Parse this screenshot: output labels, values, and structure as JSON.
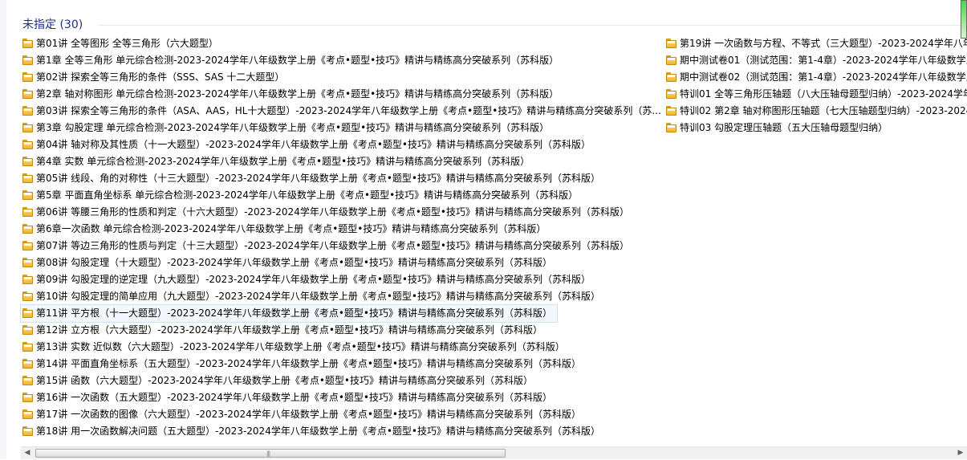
{
  "group": {
    "title": "未指定 (30)"
  },
  "left_items": [
    "第01讲 全等图形 全等三角形（六大题型）",
    "第1章 全等三角形 单元综合检测-2023-2024学年八年级数学上册《考点•题型•技巧》精讲与精练高分突破系列（苏科版）",
    "第02讲 探索全等三角形的条件（SSS、SAS 十二大题型）",
    "第2章 轴对称图形 单元综合检测-2023-2024学年八年级数学上册《考点•题型•技巧》精讲与精练高分突破系列（苏科版）",
    "第03讲 探索全等三角形的条件（ASA、AAS，HL十大题型）-2023-2024学年八年级数学上册《考点•题型•技巧》精讲与精练高分突破系列（苏...",
    "第3章 勾股定理 单元综合检测-2023-2024学年八年级数学上册《考点•题型•技巧》精讲与精练高分突破系列（苏科版）",
    "第04讲 轴对称及其性质（十一大题型）-2023-2024学年八年级数学上册《考点•题型•技巧》精讲与精练高分突破系列（苏科版）",
    "第4章 实数 单元综合检测-2023-2024学年八年级数学上册《考点•题型•技巧》精讲与精练高分突破系列（苏科版）",
    "第05讲 线段、角的对称性（十三大题型）-2023-2024学年八年级数学上册《考点•题型•技巧》精讲与精练高分突破系列（苏科版）",
    "第5章 平面直角坐标系 单元综合检测-2023-2024学年八年级数学上册《考点•题型•技巧》精讲与精练高分突破系列（苏科版）",
    "第06讲 等腰三角形的性质和判定（十六大题型）-2023-2024学年八年级数学上册《考点•题型•技巧》精讲与精练高分突破系列（苏科版）",
    "第6章一次函数 单元综合检测-2023-2024学年八年级数学上册《考点•题型•技巧》精讲与精练高分突破系列（苏科版）",
    "第07讲 等边三角形的性质与判定（十三大题型）-2023-2024学年八年级数学上册《考点•题型•技巧》精讲与精练高分突破系列（苏科版）",
    "第08讲 勾股定理（十大题型）-2023-2024学年八年级数学上册《考点•题型•技巧》精讲与精练高分突破系列（苏科版）",
    "第09讲 勾股定理的逆定理（九大题型）-2023-2024学年八年级数学上册《考点•题型•技巧》精讲与精练高分突破系列（苏科版）",
    "第10讲 勾股定理的简单应用（九大题型）-2023-2024学年八年级数学上册《考点•题型•技巧》精讲与精练高分突破系列（苏科版）",
    "第11讲 平方根（十一大题型）-2023-2024学年八年级数学上册《考点•题型•技巧》精讲与精练高分突破系列（苏科版）",
    "第12讲 立方根（六大题型）-2023-2024学年八年级数学上册《考点•题型•技巧》精讲与精练高分突破系列（苏科版）",
    "第13讲 实数 近似数（六大题型）-2023-2024学年八年级数学上册《考点•题型•技巧》精讲与精练高分突破系列（苏科版）",
    "第14讲 平面直角坐标系（五大题型）-2023-2024学年八年级数学上册《考点•题型•技巧》精讲与精练高分突破系列（苏科版）",
    "第15讲 函数（六大题型）-2023-2024学年八年级数学上册《考点•题型•技巧》精讲与精练高分突破系列（苏科版）",
    "第16讲 一次函数（五大题型）-2023-2024学年八年级数学上册《考点•题型•技巧》精讲与精练高分突破系列（苏科版）",
    "第17讲 一次函数的图像（六大题型）-2023-2024学年八年级数学上册《考点•题型•技巧》精讲与精练高分突破系列（苏科版）",
    "第18讲 用一次函数解决问题（五大题型）-2023-2024学年八年级数学上册《考点•题型•技巧》精讲与精练高分突破系列（苏科版）"
  ],
  "right_items": [
    "第19讲 一次函数与方程、不等式（三大题型）-2023-2024学年八年",
    "期中测试卷01（测试范围：第1-4章）-2023-2024学年八年级数学上",
    "期中测试卷02（测试范围：第1-4章）-2023-2024学年八年级数学上",
    "特训01 全等三角形压轴题（八大压轴母题型归纳）-2023-2024学年",
    "特训02 第2章 轴对称图形压轴题（七大压轴题型归纳）-2023-2024",
    "特训03 勾股定理压轴题（五大压轴母题型归纳）"
  ],
  "selected_index": 16,
  "icons": {
    "item": "folder-icon",
    "scroll_left": "left-arrow-icon",
    "scroll_right": "right-arrow-icon",
    "grip": "grip-icon"
  },
  "scrollbar": {
    "left_arrow": "◀",
    "right_arrow": "▶",
    "grip": "|||"
  },
  "colors": {
    "group_title": "#1e3287",
    "selection": "#cde3f9"
  }
}
